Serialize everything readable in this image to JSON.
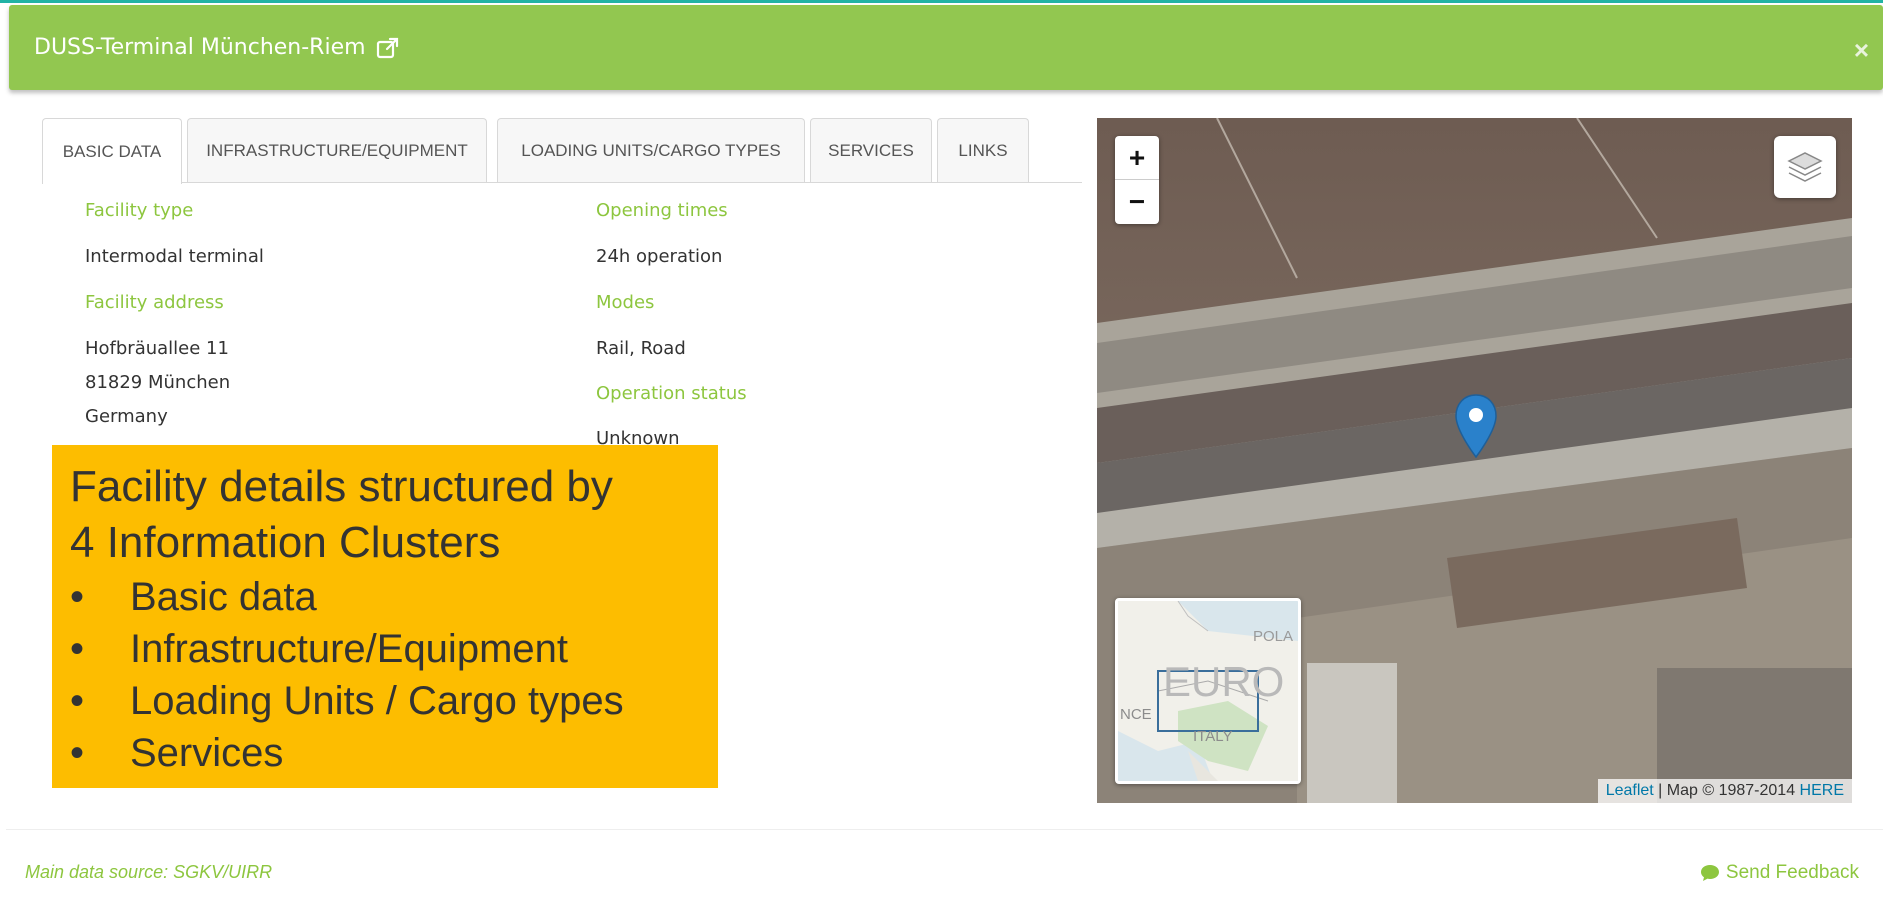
{
  "header": {
    "title": "DUSS-Terminal München-Riem",
    "close_label": "×"
  },
  "tabs": [
    {
      "label": "BASIC DATA"
    },
    {
      "label": "INFRASTRUCTURE/EQUIPMENT"
    },
    {
      "label": "LOADING UNITS/CARGO TYPES"
    },
    {
      "label": "SERVICES"
    },
    {
      "label": "LINKS"
    }
  ],
  "basic": {
    "facility_type_label": "Facility type",
    "facility_type": "Intermodal terminal",
    "address_label": "Facility address",
    "address_line1": "Hofbräuallee 11",
    "address_line2": "81829 München",
    "address_line3": "Germany",
    "opening_label": "Opening times",
    "opening": "24h operation",
    "modes_label": "Modes",
    "modes": "Rail, Road",
    "status_label": "Operation status",
    "status": "Unknown"
  },
  "callout": {
    "title_line1": "Facility details structured by",
    "title_line2": "4 Information Clusters",
    "bullet": "•",
    "items": [
      "Basic data",
      "Infrastructure/Equipment",
      "Loading Units / Cargo types",
      "Services"
    ]
  },
  "map": {
    "zoom_in": "+",
    "zoom_out": "−",
    "minimap_labels": [
      "POLA",
      "EURO",
      "NCE",
      "ITALY"
    ],
    "attribution_leaflet": "Leaflet",
    "attribution_text": " | Map © 1987-2014 ",
    "attribution_here": "HERE"
  },
  "footer": {
    "source": "Main data source: SGKV/UIRR",
    "feedback": "Send Feedback"
  },
  "colors": {
    "header_bg": "#92c750",
    "accent_green": "#8dc63f",
    "callout_bg": "#fdbd00",
    "marker_blue": "#2a81cb"
  }
}
